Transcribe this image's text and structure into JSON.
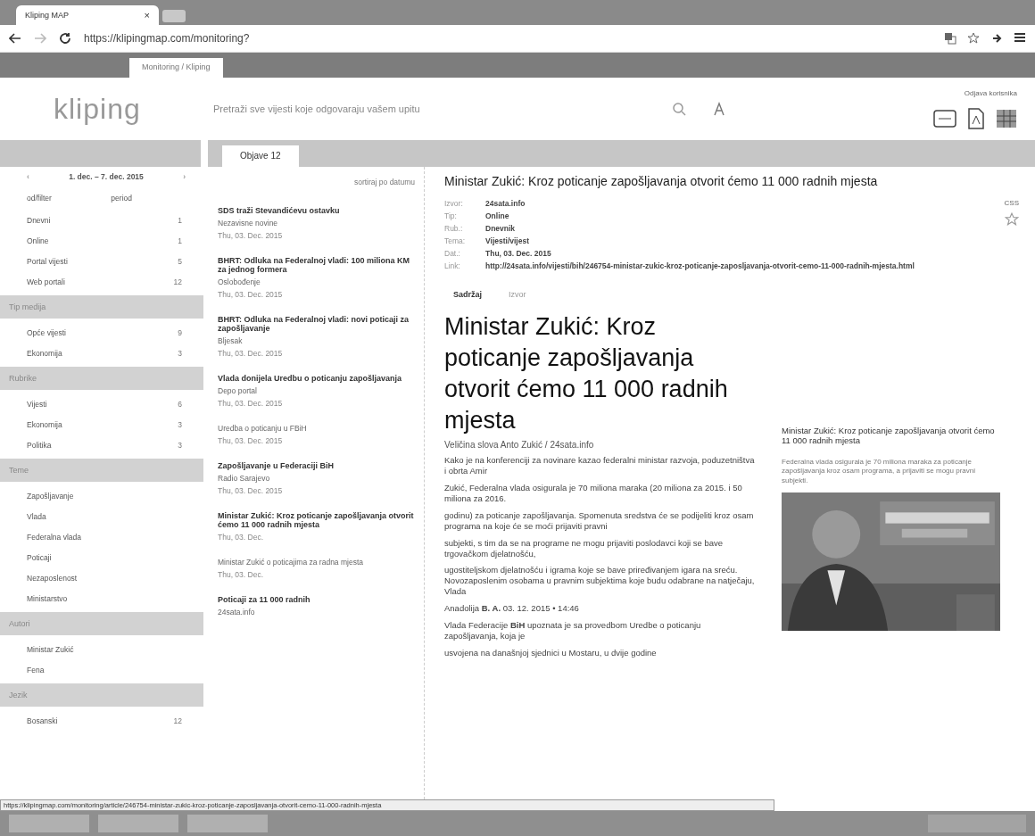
{
  "browser": {
    "tab_title": "Kliping MAP",
    "tab_close": "×",
    "url": "https://klipingmap.com/monitoring?"
  },
  "bookmark_tab": "Monitoring / Kliping",
  "header": {
    "logo": "kliping",
    "search_placeholder": "Pretraži sve vijesti koje odgovaraju vašem upitu",
    "user": "Odjava korisnika"
  },
  "sidebar": {
    "date_prev": "‹",
    "date_range": "1. dec. – 7. dec. 2015",
    "date_next": "›",
    "filter_label": "od/filter",
    "period_label": "period",
    "items": [
      {
        "kind": "item",
        "label": "Dnevni",
        "count": "1"
      },
      {
        "kind": "item",
        "label": "Online",
        "count": "1"
      },
      {
        "kind": "item",
        "label": "Portal vijesti",
        "count": "5"
      },
      {
        "kind": "item",
        "label": "Web portali",
        "count": "12"
      },
      {
        "kind": "band",
        "label": "Tip medija"
      },
      {
        "kind": "item",
        "label": "Opće vijesti",
        "count": "9"
      },
      {
        "kind": "item",
        "label": "Ekonomija",
        "count": "3"
      },
      {
        "kind": "band",
        "label": "Rubrike"
      },
      {
        "kind": "item",
        "label": "Vijesti",
        "count": "6"
      },
      {
        "kind": "item",
        "label": "Ekonomija",
        "count": "3"
      },
      {
        "kind": "item",
        "label": "Politika",
        "count": "3"
      },
      {
        "kind": "band",
        "label": "Teme"
      },
      {
        "kind": "item",
        "label": "Zapošljavanje"
      },
      {
        "kind": "item",
        "label": "Vlada"
      },
      {
        "kind": "item",
        "label": "Federalna vlada"
      },
      {
        "kind": "item",
        "label": "Poticaji"
      },
      {
        "kind": "item",
        "label": "Nezaposlenost"
      },
      {
        "kind": "item",
        "label": "Ministarstvo"
      },
      {
        "kind": "band",
        "label": "Autori"
      },
      {
        "kind": "item",
        "label": "Ministar Zukić"
      },
      {
        "kind": "item",
        "label": "Fena"
      },
      {
        "kind": "band",
        "label": "Jezik"
      },
      {
        "kind": "item",
        "label": "Bosanski",
        "count": "12"
      }
    ]
  },
  "list": {
    "tab_label": "Objave 12",
    "sort": "sortiraj po datumu",
    "articles": [
      {
        "title": "SDS traži Stevandićevu ostavku",
        "source": "Nezavisne novine",
        "date": "Thu, 03. Dec. 2015"
      },
      {
        "title": "BHRT: Odluka na Federalnoj vladi: 100 miliona KM za jednog formera",
        "source": "Oslobođenje",
        "date": "Thu, 03. Dec. 2015"
      },
      {
        "title": "BHRT: Odluka na Federalnoj vladi: novi poticaji za zapošljavanje",
        "source": "Bljesak",
        "date": "Thu, 03. Dec. 2015"
      },
      {
        "title": "Vlada donijela Uredbu o poticanju zapošljavanja",
        "source": "Depo portal",
        "date": "Thu, 03. Dec. 2015"
      },
      {
        "source": "Uredba o poticanju u FBiH",
        "date": "Thu, 03. Dec. 2015"
      },
      {
        "title": "Zapošljavanje u Federaciji BiH",
        "source": "Radio Sarajevo",
        "date": "Thu, 03. Dec. 2015"
      },
      {
        "title": "Ministar Zukić: Kroz poticanje zapošljavanja otvorit ćemo 11 000 radnih mjesta",
        "date": "Thu, 03. Dec."
      },
      {
        "source": "Ministar Zukić o poticajima za radna mjesta",
        "date": "Thu, 03. Dec."
      },
      {
        "title": "Poticaji za 11 000 radnih",
        "source": "24sata.info"
      }
    ]
  },
  "article": {
    "title": "Ministar Zukić: Kroz poticanje zapošljavanja otvorit ćemo 11 000 radnih mjesta",
    "meta": [
      {
        "label": "Izvor:",
        "value": "24sata.info"
      },
      {
        "label": "Tip:",
        "value": "Online"
      },
      {
        "label": "Rub.:",
        "value": "Dnevnik"
      },
      {
        "label": "Tema:",
        "value": "Vijesti/vijest"
      },
      {
        "label": "Dat.:",
        "value": "Thu, 03. Dec. 2015"
      },
      {
        "label": "Link:",
        "value": "http://24sata.info/vijesti/bih/246754-ministar-zukic-kroz-poticanje-zaposljavanja-otvorit-cemo-11-000-radnih-mjesta.html"
      }
    ],
    "badge": "CSS",
    "tabs": [
      {
        "label": "Sadržaj",
        "selected": true
      },
      {
        "label": "Izvor",
        "selected": false
      }
    ],
    "headline": "Ministar Zukić: Kroz poticanje zapošljavanja otvorit ćemo 11 000 radnih mjesta",
    "byline": "Veličina slova  Anto Zukić / 24sata.info",
    "paragraphs": [
      "Kako je na konferenciji za novinare kazao federalni ministar razvoja, poduzetništva i obrta Amir",
      "Zukić, Federalna vlada osigurala je 70 miliona maraka (20 miliona za 2015. i 50 miliona za 2016.",
      "godinu) za poticanje zapošljavanja. Spomenuta sredstva će se podijeliti kroz osam programa na koje će se moći prijaviti pravni",
      "subjekti, s tim da se na programe ne mogu prijaviti poslodavci koji se bave trgovačkom djelatnošću,",
      "ugostiteljskom djelatnošću i igrama koje se bave priređivanjem igara na sreću. Novozaposlenim osobama u pravnim subjektima koje budu odabrane na natječaju, Vlada",
      "Anadolija **B. A.** 03. 12. 2015 • 14:46",
      "Vlada Federacije **BiH** upoznata je sa provedbom Uredbe o poticanju zapošljavanja, koja je",
      "usvojena na današnjoj sjednici u Mostaru, u dvije godine"
    ],
    "card": {
      "title": "Ministar Zukić: Kroz poticanje zapošljavanja otvorit ćemo 11 000 radnih mjesta",
      "intro": "Federalna vlada osigurala je 70 miliona maraka za poticanje zapošljavanja kroz osam programa, a prijaviti se mogu pravni subjekti."
    }
  },
  "status_url": "https://klipingmap.com/monitoring/article/246754-ministar-zukic-kroz-poticanje-zaposljavanja-otvorit-cemo-11-000-radnih-mjesta"
}
